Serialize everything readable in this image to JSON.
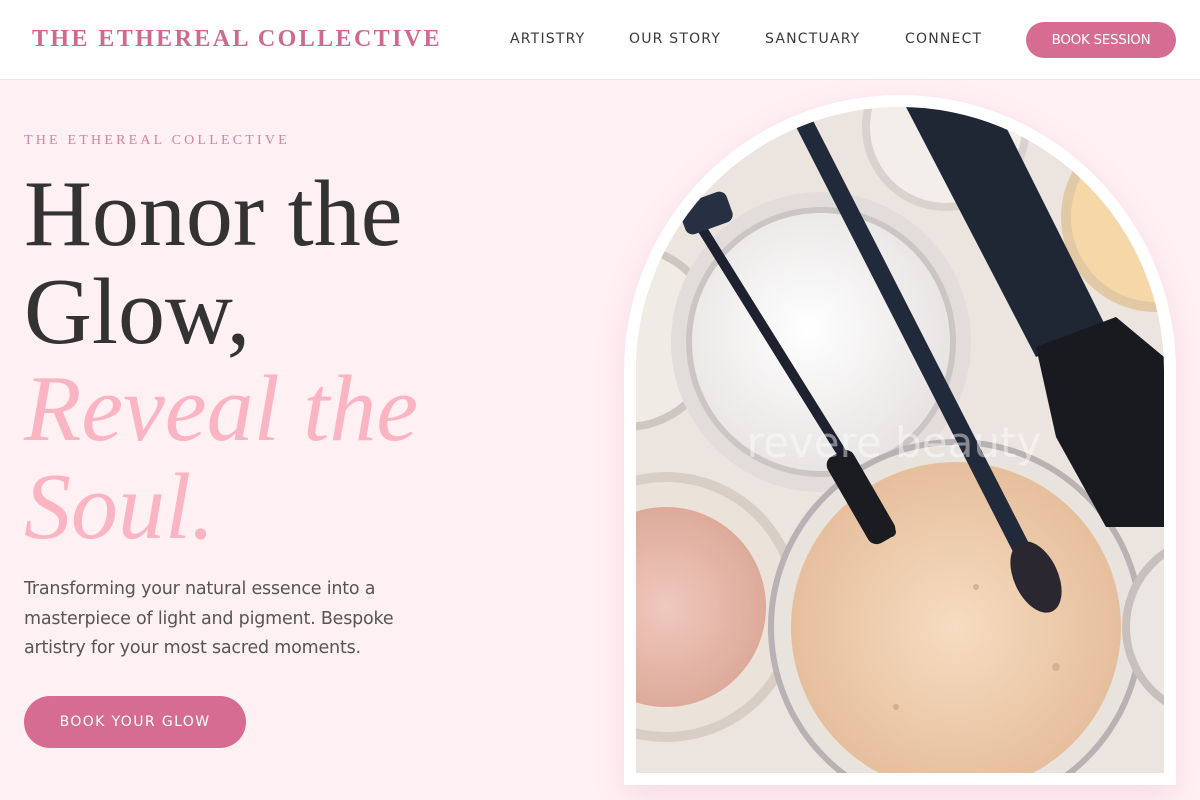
{
  "header": {
    "brand": "THE ETHEREAL COLLECTIVE",
    "nav": [
      "ARTISTRY",
      "OUR STORY",
      "SANCTUARY",
      "CONNECT"
    ],
    "book_button": "BOOK SESSION"
  },
  "hero": {
    "eyebrow": "THE ETHEREAL COLLECTIVE",
    "headline_lines": [
      "Honor the",
      "Glow,",
      "Reveal the",
      "Soul."
    ],
    "description": "Transforming your natural essence into a masterpiece of light and pigment. Bespoke artistry for your most sacred moments.",
    "cta": "BOOK YOUR GLOW",
    "image_watermark": "revere beauty"
  },
  "colors": {
    "accent": "#d76c93",
    "brand_text": "#d0688f",
    "headline_dark": "#333333",
    "headline_pink": "#fbb4c2",
    "background": "#fff0f4"
  }
}
